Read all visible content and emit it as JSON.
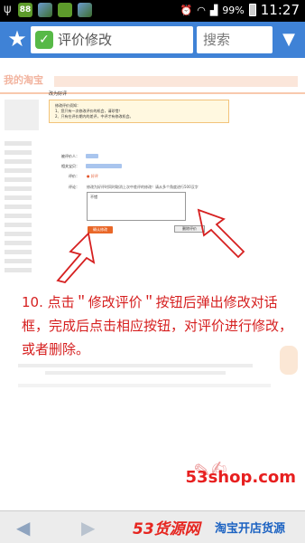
{
  "status_bar": {
    "battery": "99%",
    "time": "11:27",
    "app_badge": "88"
  },
  "browser": {
    "url_title": "评价修改",
    "search_placeholder": "搜索"
  },
  "page": {
    "logo": "我的淘宝",
    "form_title": "改为好评",
    "notice": {
      "heading": "修改评价须知：",
      "line1": "1、您只有一次修改评价的机会，请珍惜！",
      "line2": "2、只有在评价期内的差评，中评才有修改机会。"
    },
    "labels": {
      "target": "被评价人：",
      "item": "相关宝贝：",
      "rating": "评价：",
      "remark": "评论："
    },
    "rating_value": "好评",
    "remark_hint": "修改为好评时同时取消上次中差评的修改！请从多个角度进行500汉字",
    "textarea_value": "不错",
    "confirm_button": "确认修改",
    "delete_button": "删除评价"
  },
  "instruction": {
    "text": "10. 点击＂修改评价＂按钮后弹出修改对话框，完成后点击相应按钮，对评价进行修改，或者删除。"
  },
  "watermark": {
    "url": "53shop.com",
    "brand": "53货源网",
    "slogan": "淘宝开店货源"
  },
  "colors": {
    "browser_bar": "#3f82d6",
    "instruction_red": "#d62020",
    "confirm_orange": "#e96728"
  },
  "icons": {
    "star": "star-icon",
    "shield": "shield-check-icon",
    "chevron": "chevron-down-icon",
    "back": "back-arrow-icon",
    "forward": "forward-arrow-icon"
  }
}
